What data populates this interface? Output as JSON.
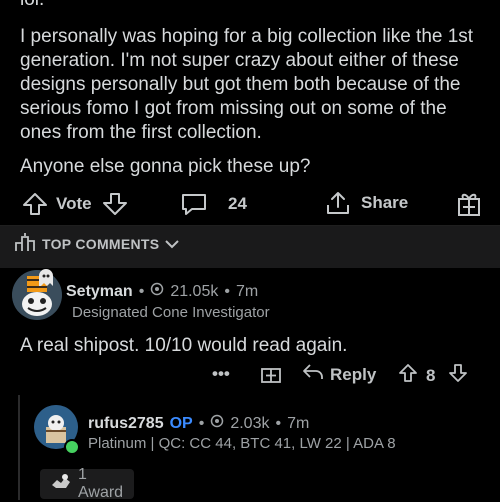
{
  "post": {
    "cut_line": "lol.",
    "paragraph1": "I personally was hoping for a big collection like the 1st generation. I'm not super crazy about either of these designs personally but got them both because of the serious fomo I got from missing out on some of the ones from the first collection.",
    "paragraph2": "Anyone else gonna pick these up?"
  },
  "post_actions": {
    "vote_label": "Vote",
    "comment_count": "24",
    "share_label": "Share"
  },
  "comments_header": {
    "label": "TOP COMMENTS"
  },
  "comment1": {
    "username": "Setyman",
    "karma": "21.05k",
    "age": "7m",
    "flair": "Designated Cone Investigator",
    "text": "A real shipost. 10/10 would read again.",
    "more": "•••",
    "reply_label": "Reply",
    "score": "8"
  },
  "comment2": {
    "username": "rufus2785",
    "op_badge": "OP",
    "karma": "2.03k",
    "age": "7m",
    "flair": "Platinum | QC: CC 44, BTC 41, LW 22 | ADA 8",
    "award_label": "1 Award"
  },
  "colors": {
    "background": "#000000",
    "text": "#d7dadc",
    "muted": "#9ea2a5",
    "op_blue": "#3b8bff",
    "header_bg": "#1a1a1b"
  }
}
